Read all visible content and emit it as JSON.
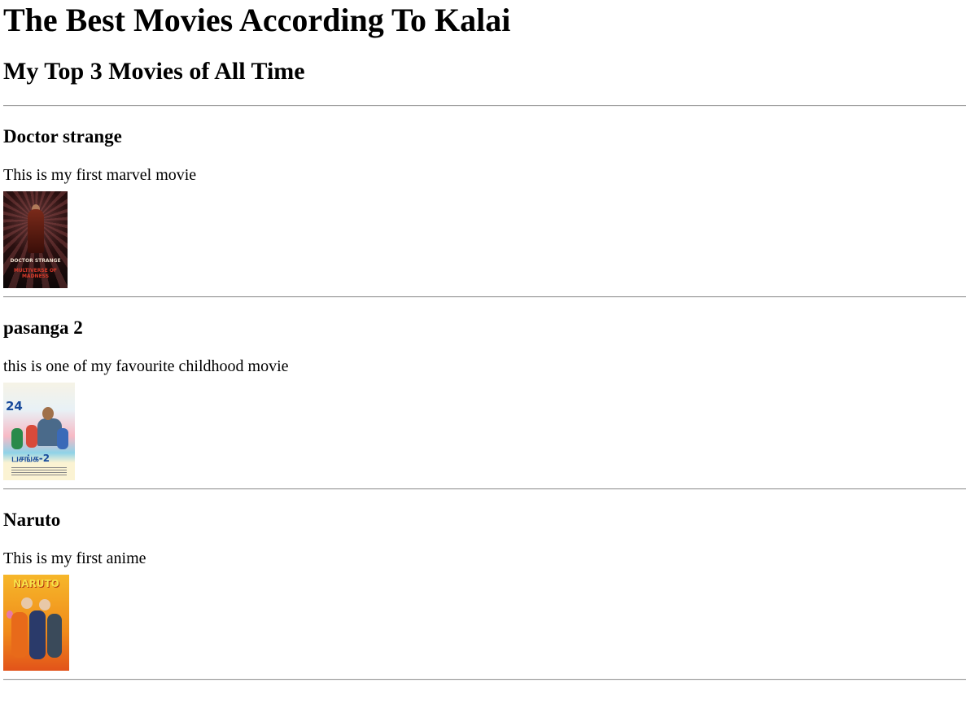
{
  "heading": "The Best Movies According To Kalai",
  "subheading": "My Top 3 Movies of All Time",
  "movies": [
    {
      "title": "Doctor strange",
      "description": "This is my first marvel movie",
      "poster_icon": "doctor-strange-poster",
      "poster_text_top": "DOCTOR STRANGE",
      "poster_text_bottom": "MULTIVERSE OF MADNESS"
    },
    {
      "title": "pasanga 2",
      "description": "this is one of my favourite childhood movie",
      "poster_icon": "pasanga-2-poster",
      "poster_number": "24",
      "poster_title": "பசங்க-2"
    },
    {
      "title": "Naruto",
      "description": "This is my first anime",
      "poster_icon": "naruto-poster",
      "poster_logo": "NARUTO"
    }
  ]
}
